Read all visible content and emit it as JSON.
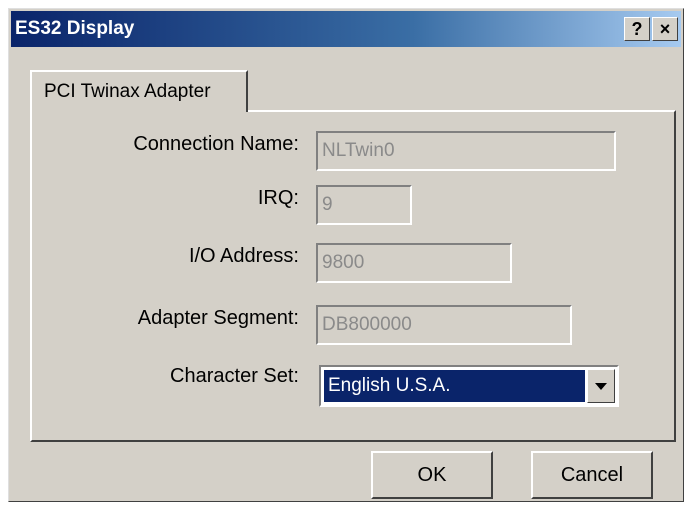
{
  "window": {
    "title": "ES32 Display",
    "help_label": "?",
    "close_label": "×"
  },
  "tabs": [
    {
      "label": "PCI Twinax Adapter"
    }
  ],
  "form": {
    "connection_name": {
      "label": "Connection Name:",
      "value": "NLTwin0"
    },
    "irq": {
      "label": "IRQ:",
      "value": "9"
    },
    "io_address": {
      "label": "I/O Address:",
      "value": "9800"
    },
    "adapter_segment": {
      "label": "Adapter Segment:",
      "value": "DB800000"
    },
    "character_set": {
      "label": "Character Set:",
      "value": "English U.S.A."
    }
  },
  "buttons": {
    "ok": "OK",
    "cancel": "Cancel"
  },
  "colors": {
    "title_bar": "#0a246a",
    "face": "#d4d0c8",
    "selection": "#0a246a"
  }
}
